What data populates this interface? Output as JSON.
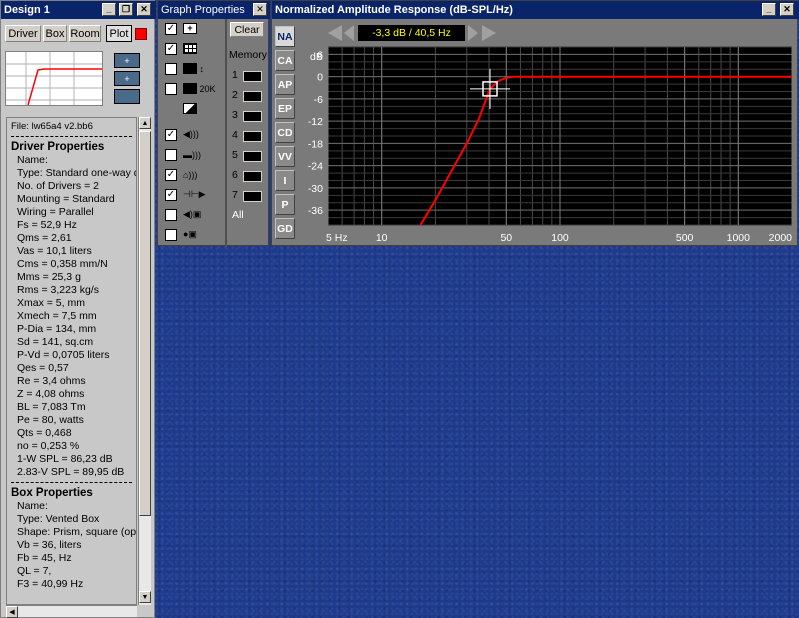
{
  "design_window": {
    "title": "Design 1",
    "tabs": [
      "Driver",
      "Box",
      "Room",
      "Plot"
    ],
    "file_label": "File: lw65a4 v2.bb6",
    "driver_heading": "Driver Properties",
    "driver_lines": [
      "Name:",
      "Type: Standard one-way d",
      "No. of Drivers = 2",
      "Mounting = Standard",
      "Wiring = Parallel",
      "Fs =  52,9 Hz",
      "Qms =  2,61",
      "Vas =  10,1 liters",
      "Cms =  0,358 mm/N",
      "Mms =  25,3 g",
      "Rms =  3,223 kg/s",
      "Xmax =  5, mm",
      "Xmech =  7,5 mm",
      "P-Dia =  134, mm",
      "Sd =  141, sq.cm",
      "P-Vd =  0,0705 liters",
      "Qes =  0,57",
      "Re =  3,4 ohms",
      "Z =  4,08 ohms",
      "BL =  7,083 Tm",
      "Pe =  80, watts",
      "Qts =  0,468",
      "no =  0,253 %",
      "1-W SPL =  86,23 dB",
      "2.83-V SPL =  89,95 dB"
    ],
    "box_heading": "Box Properties",
    "box_lines": [
      "Name:",
      "Type: Vented Box",
      "Shape: Prism, square (opt",
      "Vb =  36, liters",
      "Fb =  45, Hz",
      "QL =  7,",
      "F3 =  40,99 Hz"
    ]
  },
  "graph_properties": {
    "title": "Graph Properties",
    "clear_label": "Clear",
    "memory_label": "Memory",
    "memory_slots": [
      "1",
      "2",
      "3",
      "4",
      "5",
      "6",
      "7"
    ],
    "all_label": "All",
    "label_20k": "20K",
    "plus_glyph": "+",
    "check_glyph": "✓"
  },
  "graph_window": {
    "title": "Normalized Amplitude Response (dB-SPL/Hz)",
    "readout": "-3,3 dB / 40,5 Hz",
    "side_tabs": [
      "NA",
      "CA",
      "AP",
      "EP",
      "CD",
      "VV",
      "I",
      "P",
      "GD"
    ]
  },
  "window_buttons": {
    "minimize": "_",
    "restore": "❐",
    "close": "✕"
  },
  "colors": {
    "titlebar": "#0a246a",
    "curve": "#ff0000",
    "plot_bg": "#000000",
    "readout_text": "#ffff00"
  },
  "chart_data": {
    "type": "line",
    "xscale": "log",
    "xlim": [
      5,
      2000
    ],
    "ylim": [
      -40,
      8
    ],
    "yunit": "dB",
    "x_ticks": [
      5,
      10,
      50,
      100,
      500,
      1000,
      2000
    ],
    "x_tick_labels": [
      "5 Hz",
      "10",
      "50",
      "100",
      "500",
      "1000",
      "2000"
    ],
    "y_ticks": [
      6,
      0,
      -6,
      -12,
      -18,
      -24,
      -30,
      -36
    ],
    "y_tick_labels": [
      "6",
      "0",
      "-6",
      "-12",
      "-18",
      "-24",
      "-30",
      "-36"
    ],
    "series": [
      {
        "x": [
          16.5,
          20,
          25,
          30,
          35,
          40.5,
          45,
          50,
          55,
          60,
          100,
          500,
          2000
        ],
        "y": [
          -40,
          -33.3,
          -24.9,
          -18,
          -11.5,
          -3.3,
          -1.2,
          -0.3,
          0,
          0,
          0,
          0,
          0
        ]
      }
    ],
    "cursor": {
      "x": 40.5,
      "y": -3.3
    }
  }
}
